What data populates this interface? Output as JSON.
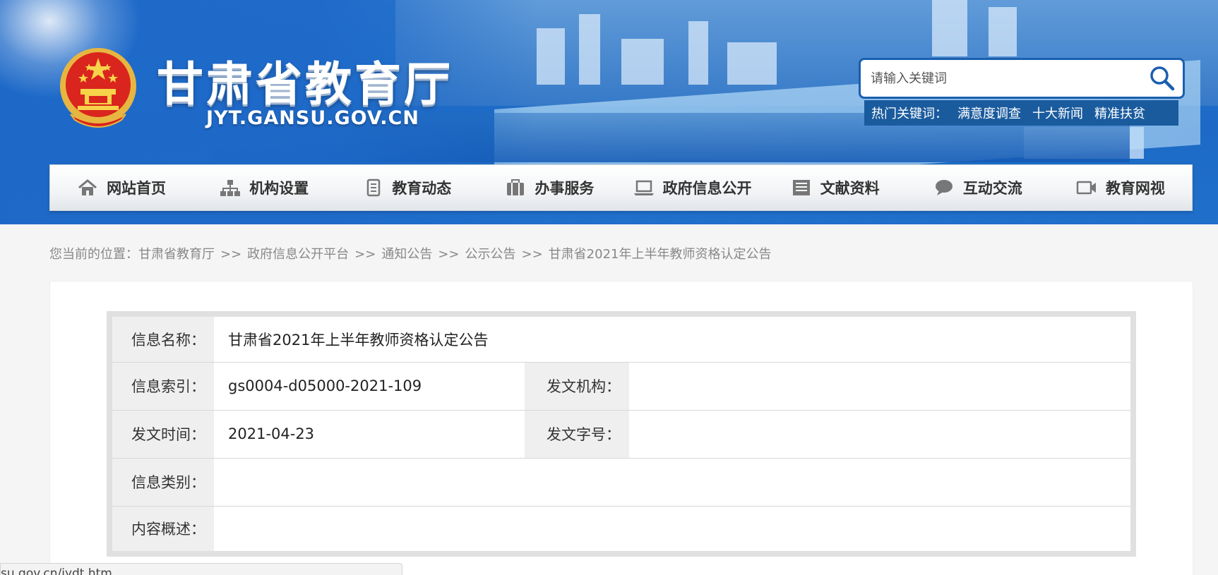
{
  "header": {
    "title": "甘肃省教育厅",
    "domain": "JYT.GANSU.GOV.CN",
    "search": {
      "placeholder": "请输入关键词"
    },
    "hot_label": "热门关键词：",
    "hot_keywords": [
      "满意度调查",
      "十大新闻",
      "精准扶贫"
    ]
  },
  "nav": {
    "items": [
      {
        "label": "网站首页",
        "icon": "home-icon"
      },
      {
        "label": "机构设置",
        "icon": "org-chart-icon"
      },
      {
        "label": "教育动态",
        "icon": "document-icon"
      },
      {
        "label": "办事服务",
        "icon": "briefcase-icon"
      },
      {
        "label": "政府信息公开",
        "icon": "laptop-icon"
      },
      {
        "label": "文献资料",
        "icon": "archive-icon"
      },
      {
        "label": "互动交流",
        "icon": "chat-icon"
      },
      {
        "label": "教育网视",
        "icon": "video-icon"
      }
    ]
  },
  "breadcrumb": {
    "prefix": "您当前的位置：",
    "separator": ">>",
    "items": [
      "甘肃省教育厅",
      "政府信息公开平台",
      "通知公告",
      "公示公告",
      "甘肃省2021年上半年教师资格认定公告"
    ]
  },
  "info": {
    "name_label": "信息名称：",
    "name_value": "甘肃省2021年上半年教师资格认定公告",
    "index_label": "信息索引：",
    "index_value": "gs0004-d05000-2021-109",
    "org_label": "发文机构：",
    "org_value": "",
    "date_label": "发文时间：",
    "date_value": "2021-04-23",
    "docno_label": "发文字号：",
    "docno_value": "",
    "category_label": "信息类别：",
    "category_value": "",
    "summary_label": "内容概述：",
    "summary_value": ""
  },
  "status_bar": {
    "url": "su.gov.cn/jydt.htm"
  },
  "colors": {
    "header_blue": "#1f6fcb",
    "search_border": "#1a5fae",
    "hot_bg": "#1a5b9e"
  }
}
